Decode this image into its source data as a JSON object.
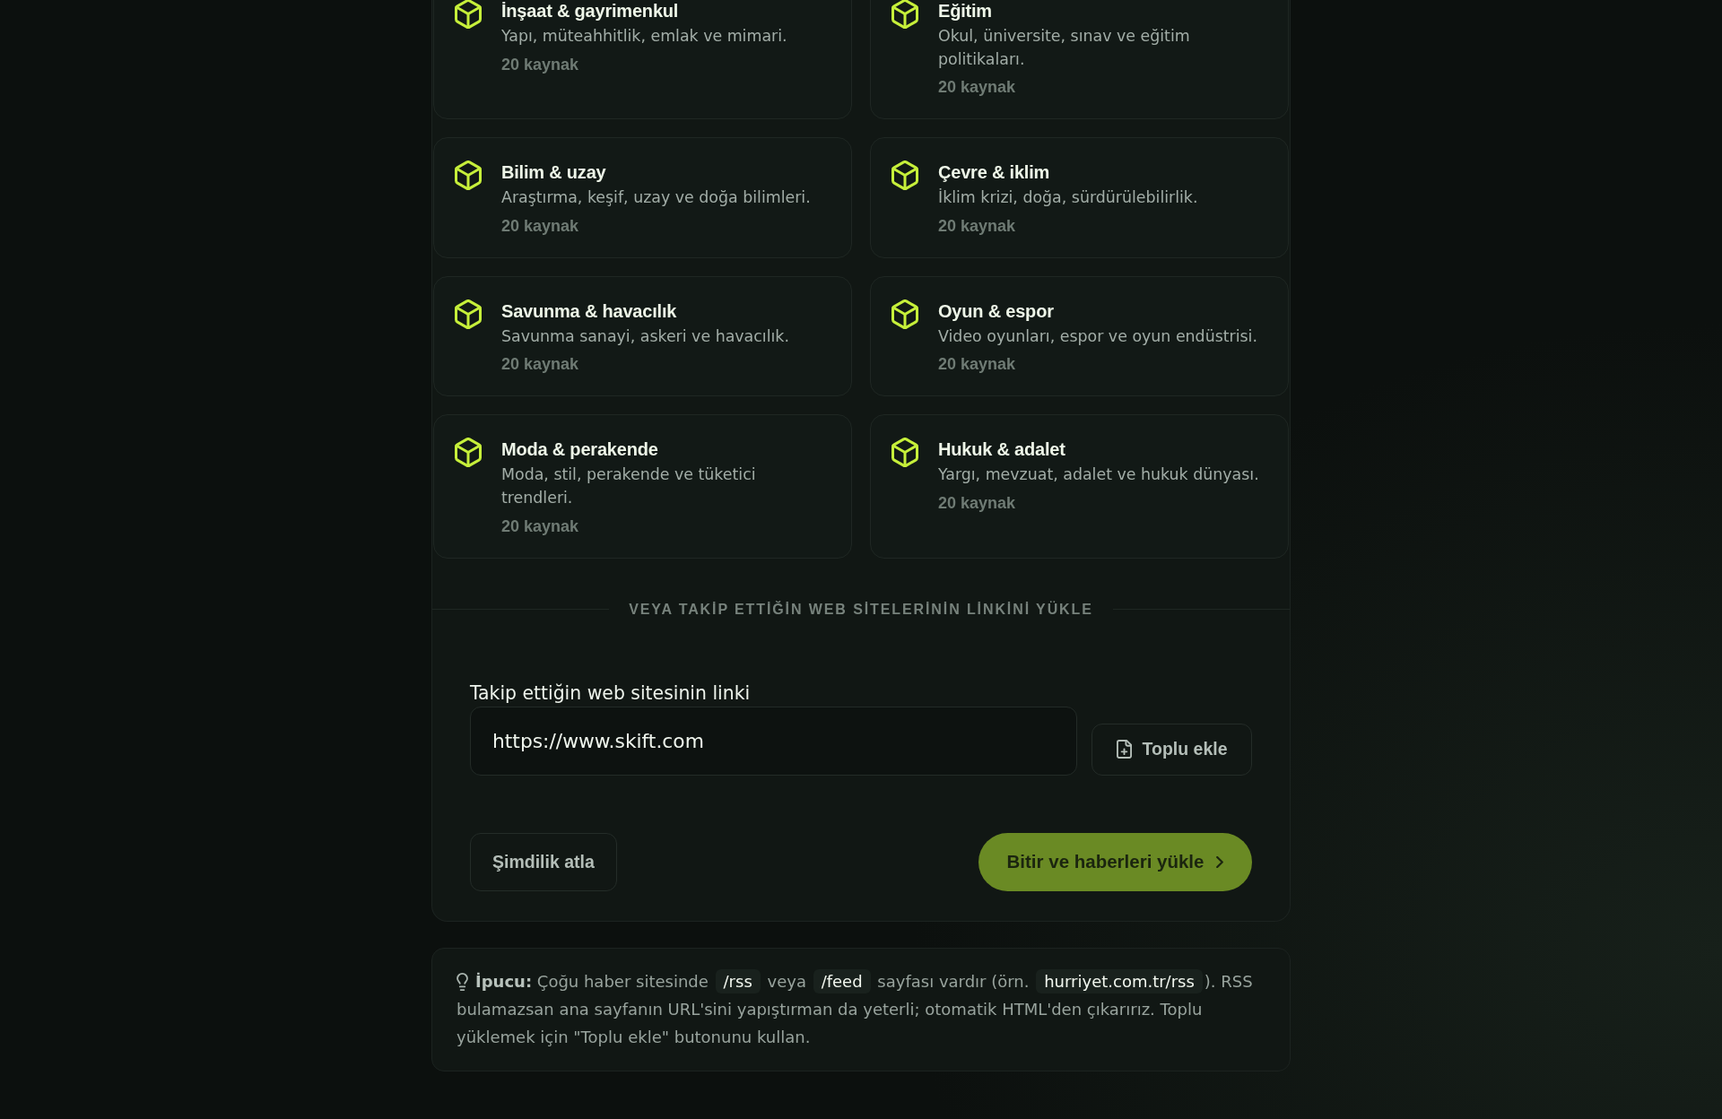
{
  "categories": [
    {
      "title": "İnşaat & gayrimenkul",
      "description": "Yapı, müteahhitlik, emlak ve mimari.",
      "count": "20 kaynak"
    },
    {
      "title": "Eğitim",
      "description": "Okul, üniversite, sınav ve eğitim politikaları.",
      "count": "20 kaynak"
    },
    {
      "title": "Bilim & uzay",
      "description": "Araştırma, keşif, uzay ve doğa bilimleri.",
      "count": "20 kaynak"
    },
    {
      "title": "Çevre & iklim",
      "description": "İklim krizi, doğa, sürdürülebilirlik.",
      "count": "20 kaynak"
    },
    {
      "title": "Savunma & havacılık",
      "description": "Savunma sanayi, askeri ve havacılık.",
      "count": "20 kaynak"
    },
    {
      "title": "Oyun & espor",
      "description": "Video oyunları, espor ve oyun endüstrisi.",
      "count": "20 kaynak"
    },
    {
      "title": "Moda & perakende",
      "description": "Moda, stil, perakende ve tüketici trendleri.",
      "count": "20 kaynak"
    },
    {
      "title": "Hukuk & adalet",
      "description": "Yargı, mevzuat, adalet ve hukuk dünyası.",
      "count": "20 kaynak"
    }
  ],
  "divider": {
    "label": "VEYA TAKİP ETTİĞİN WEB SİTELERİNİN LİNKİNİ YÜKLE"
  },
  "url_field": {
    "label": "Takip ettiğin web sitesinin linki",
    "value": "https://www.skift.com"
  },
  "bulk_add_button": {
    "label": "Toplu ekle"
  },
  "skip_button": {
    "label": "Şimdilik atla"
  },
  "finish_button": {
    "label": "Bitir ve haberleri yükle"
  },
  "tip": {
    "segments": [
      {
        "kind": "label",
        "text": "İpucu:"
      },
      {
        "kind": "text",
        "text": " Çoğu haber sitesinde "
      },
      {
        "kind": "code",
        "text": "/rss"
      },
      {
        "kind": "text",
        "text": " veya "
      },
      {
        "kind": "code",
        "text": "/feed"
      },
      {
        "kind": "text",
        "text": " sayfası vardır (örn. "
      },
      {
        "kind": "code",
        "text": "hurriyet.com.tr/rss"
      },
      {
        "kind": "text",
        "text": "). RSS bulamazsan ana sayfanın URL'sini yapıştırman da yeterli; otomatik HTML'den çıkarırız. Toplu yüklemek için \"Toplu ekle\" butonunu kullan."
      }
    ]
  }
}
